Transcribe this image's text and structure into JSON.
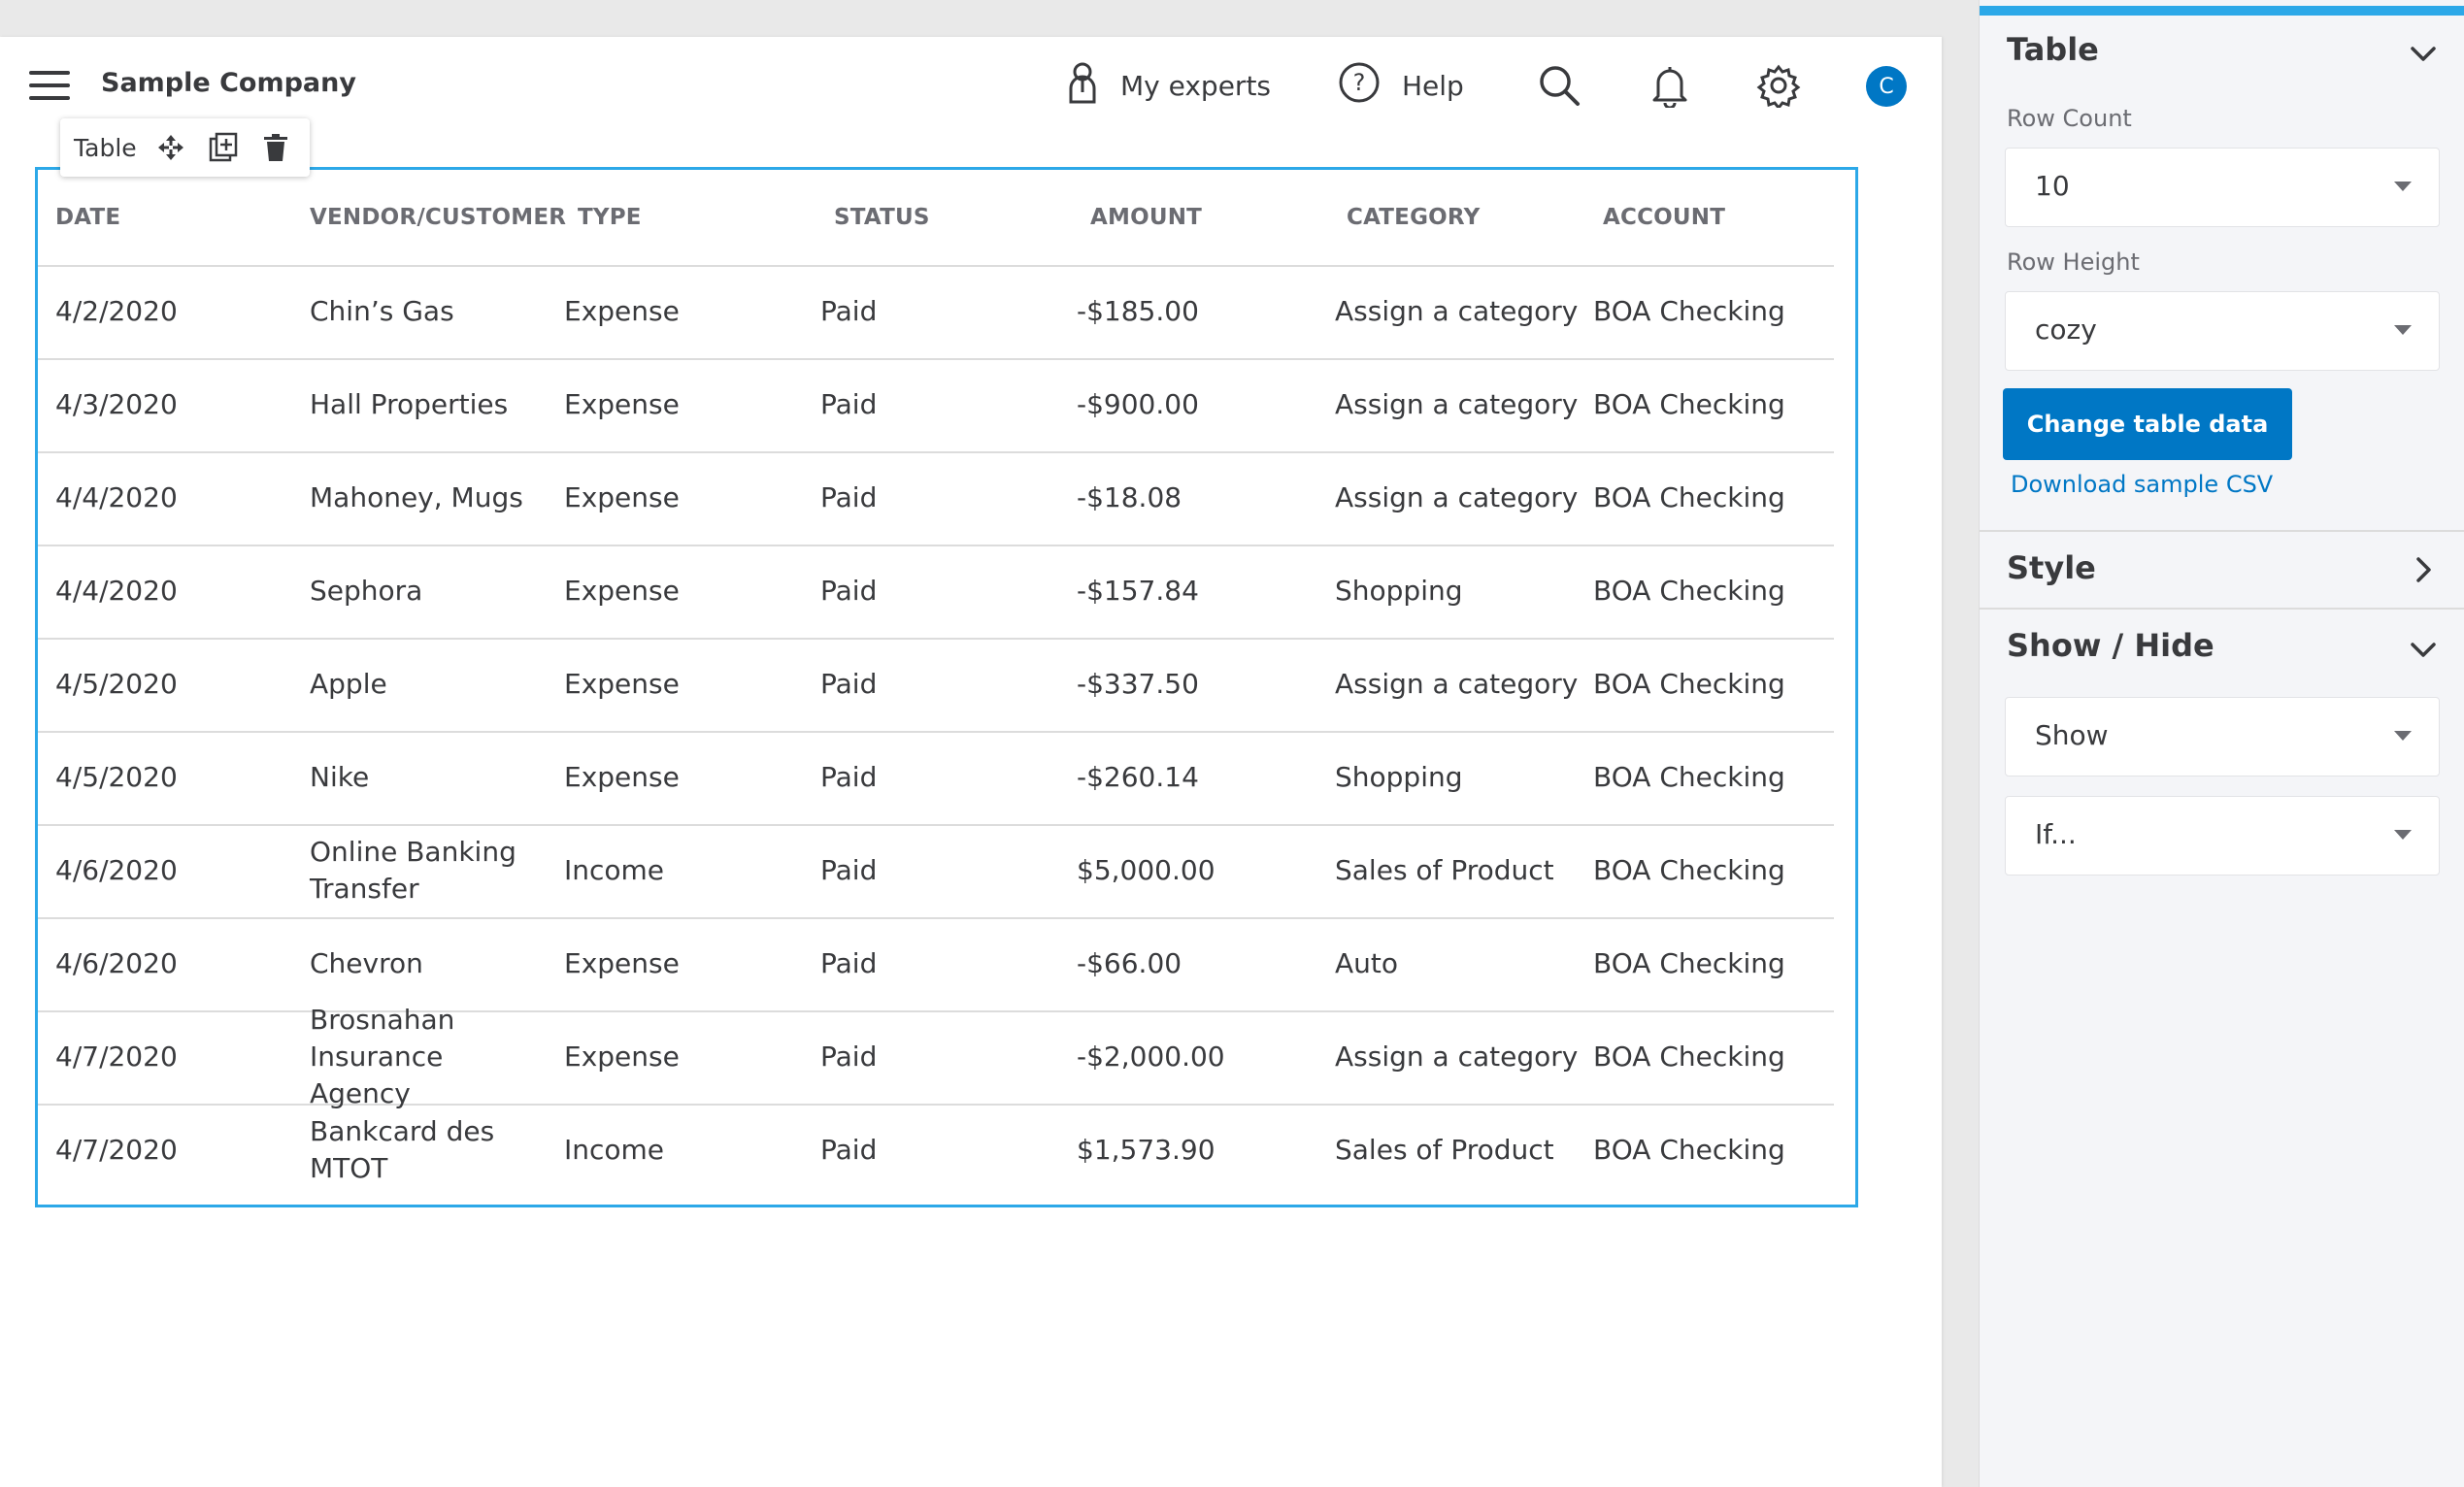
{
  "header": {
    "company": "Sample Company",
    "my_experts": "My experts",
    "help": "Help",
    "avatar_initial": "C"
  },
  "widget_toolbar": {
    "label": "Table"
  },
  "table": {
    "columns": [
      "DATE",
      "VENDOR/CUSTOMER",
      "TYPE",
      "STATUS",
      "AMOUNT",
      "CATEGORY",
      "ACCOUNT"
    ],
    "rows": [
      [
        "4/2/2020",
        "Chin’s Gas",
        "Expense",
        "Paid",
        "-$185.00",
        "Assign a category",
        "BOA Checking"
      ],
      [
        "4/3/2020",
        "Hall Properties",
        "Expense",
        "Paid",
        "-$900.00",
        "Assign a category",
        "BOA Checking"
      ],
      [
        "4/4/2020",
        "Mahoney, Mugs",
        "Expense",
        "Paid",
        "-$18.08",
        "Assign a category",
        "BOA Checking"
      ],
      [
        "4/4/2020",
        "Sephora",
        "Expense",
        "Paid",
        "-$157.84",
        "Shopping",
        "BOA Checking"
      ],
      [
        "4/5/2020",
        "Apple",
        "Expense",
        "Paid",
        "-$337.50",
        "Assign a category",
        "BOA Checking"
      ],
      [
        "4/5/2020",
        "Nike",
        "Expense",
        "Paid",
        "-$260.14",
        "Shopping",
        "BOA Checking"
      ],
      [
        "4/6/2020",
        "Online Banking Transfer",
        "Income",
        "Paid",
        "$5,000.00",
        "Sales of Product",
        "BOA Checking"
      ],
      [
        "4/6/2020",
        "Chevron",
        "Expense",
        "Paid",
        "-$66.00",
        "Auto",
        "BOA Checking"
      ],
      [
        "4/7/2020",
        "Brosnahan Insurance Agency",
        "Expense",
        "Paid",
        "-$2,000.00",
        "Assign a category",
        "BOA Checking"
      ],
      [
        "4/7/2020",
        "Bankcard des MTOT",
        "Income",
        "Paid",
        "$1,573.90",
        "Sales of Product",
        "BOA Checking"
      ]
    ]
  },
  "panel": {
    "table_section": {
      "title": "Table",
      "row_count_label": "Row Count",
      "row_count_value": "10",
      "row_height_label": "Row Height",
      "row_height_value": "cozy",
      "change_button": "Change table data",
      "download_link": "Download sample CSV"
    },
    "style_section": {
      "title": "Style"
    },
    "show_hide_section": {
      "title": "Show / Hide",
      "show_value": "Show",
      "condition_value": "If..."
    }
  },
  "colors": {
    "accent": "#2ca8e8",
    "primary": "#0077c5",
    "text": "#393a3d",
    "muted": "#6b6c72"
  }
}
